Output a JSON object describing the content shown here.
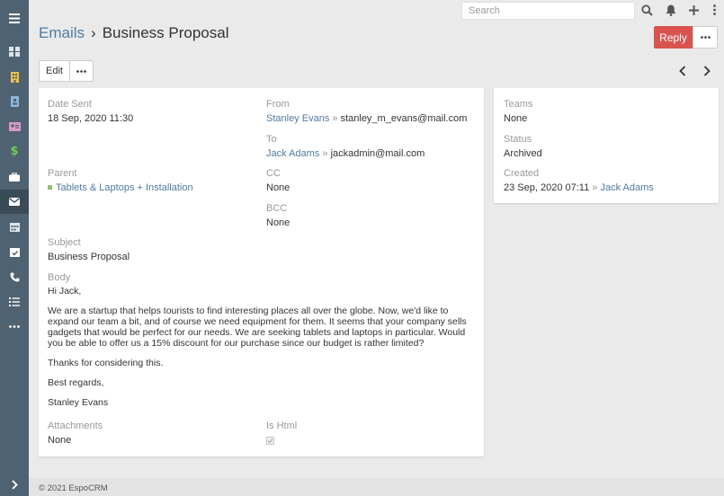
{
  "topbar": {
    "search_placeholder": "Search"
  },
  "header": {
    "breadcrumb_parent": "Emails",
    "breadcrumb_separator": "›",
    "breadcrumb_current": "Business Proposal",
    "reply_label": "Reply",
    "edit_label": "Edit"
  },
  "colors": {
    "sidebar": "#4f6272",
    "sidebar_active": "#3a4b58",
    "link": "#4f7aa0",
    "reply_button": "#d9534f"
  },
  "sidebar": {
    "items": [
      {
        "name": "dashboard",
        "icon": "dashboard-icon"
      },
      {
        "name": "accounts",
        "icon": "building-icon"
      },
      {
        "name": "contacts",
        "icon": "contact-book-icon"
      },
      {
        "name": "leads",
        "icon": "id-card-icon"
      },
      {
        "name": "opportunities",
        "icon": "dollar-icon"
      },
      {
        "name": "cases",
        "icon": "briefcase-icon"
      },
      {
        "name": "emails",
        "icon": "envelope-icon",
        "active": true
      },
      {
        "name": "calendar",
        "icon": "calendar-icon"
      },
      {
        "name": "meetings",
        "icon": "calendar-check-icon"
      },
      {
        "name": "calls",
        "icon": "phone-icon"
      },
      {
        "name": "tasks",
        "icon": "task-list-icon"
      },
      {
        "name": "more",
        "icon": "more-dots-icon"
      }
    ]
  },
  "email": {
    "date_sent_label": "Date Sent",
    "date_sent": "18 Sep, 2020 11:30",
    "from_label": "From",
    "from_name": "Stanley Evans",
    "from_sep": "»",
    "from_email": "stanley_m_evans@mail.com",
    "to_label": "To",
    "to_name": "Jack Adams",
    "to_sep": "»",
    "to_email": "jackadmin@mail.com",
    "parent_label": "Parent",
    "parent_value": "Tablets & Laptops + Installation",
    "cc_label": "CC",
    "cc_value": "None",
    "bcc_label": "BCC",
    "bcc_value": "None",
    "subject_label": "Subject",
    "subject_value": "Business Proposal",
    "body_label": "Body",
    "body": {
      "greeting": "Hi Jack,",
      "paragraph": "We are a startup that helps tourists to find interesting places all over the globe. Now, we'd like to expand our team a bit, and of course we need equipment for them. It seems that your company sells gadgets that would be perfect for our needs. We are seeking tablets and laptops in particular. Would you be able to offer us a 15% discount for our purchase since our budget is rather limited?",
      "thanks": "Thanks for considering this.",
      "regards": "Best regards,",
      "signature": "Stanley Evans"
    },
    "attachments_label": "Attachments",
    "attachments_value": "None",
    "is_html_label": "Is Html",
    "is_html": true
  },
  "side": {
    "teams_label": "Teams",
    "teams_value": "None",
    "status_label": "Status",
    "status_value": "Archived",
    "created_label": "Created",
    "created_value": "23 Sep, 2020 07:11",
    "created_sep": "»",
    "created_by": "Jack Adams"
  },
  "footer": {
    "text": "© 2021 EspoCRM"
  }
}
